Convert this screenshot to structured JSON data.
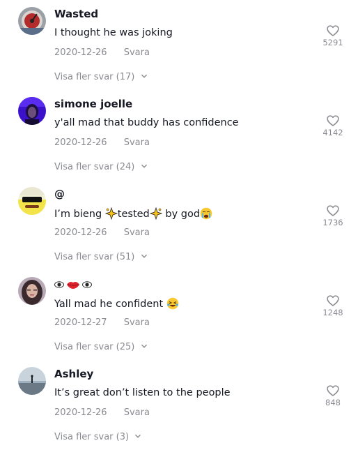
{
  "comments": [
    {
      "username": "Wasted",
      "text": "I thought he was joking",
      "date": "2020-12-26",
      "reply_label": "Svara",
      "view_replies": "Visa fler svar (17)",
      "likes": "5291",
      "avatar": "red-gauge-avatar"
    },
    {
      "username": "simone joelle",
      "text": "y'all mad that buddy has confidence",
      "date": "2020-12-26",
      "reply_label": "Svara",
      "view_replies": "Visa fler svar (24)",
      "likes": "4142",
      "avatar": "purple-portrait-avatar"
    },
    {
      "username": "@",
      "text_parts": [
        "I’m bieng ",
        "tested",
        " by god"
      ],
      "date": "2020-12-26",
      "reply_label": "Svara",
      "view_replies": "Visa fler svar (51)",
      "likes": "1736",
      "avatar": "spongebob-sunglasses-avatar"
    },
    {
      "username_icons": [
        "eye-icon",
        "lips-icon",
        "eye-icon"
      ],
      "text": "Yall mad he confident",
      "date": "2020-12-27",
      "reply_label": "Svara",
      "view_replies": "Visa fler svar (25)",
      "likes": "1248",
      "avatar": "girl-portrait-avatar"
    },
    {
      "username": "Ashley",
      "text": "It’s great don’t listen to the people",
      "date": "2020-12-26",
      "reply_label": "Svara",
      "view_replies": "Visa fler svar (3)",
      "likes": "848",
      "avatar": "beach-silhouette-avatar"
    }
  ],
  "colors": {
    "primary_text": "#161823",
    "secondary_text": "#8a8b91"
  }
}
